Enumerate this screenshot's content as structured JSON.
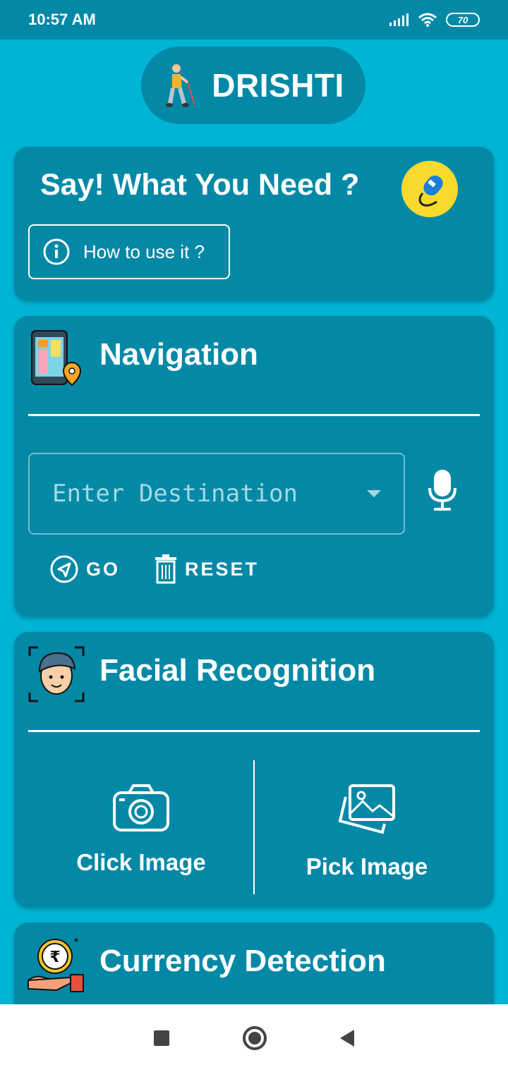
{
  "status_bar": {
    "time": "10:57 AM",
    "battery": "70",
    "icons": [
      "signal-icon",
      "wifi-icon",
      "battery-icon"
    ]
  },
  "app": {
    "title": "DRISHTI",
    "logo_icon": "blind-person-with-cane-icon"
  },
  "voice_card": {
    "title": "Say! What You Need ?",
    "mic_icon": "microphone-icon",
    "help_button": "How to use it ?"
  },
  "navigation": {
    "title": "Navigation",
    "icon": "map-phone-icon",
    "destination_placeholder": "Enter Destination",
    "go_label": "GO",
    "reset_label": "RESET"
  },
  "facial_recognition": {
    "title": "Facial Recognition",
    "icon": "face-scan-icon",
    "click_image_label": "Click Image",
    "pick_image_label": "Pick Image"
  },
  "currency_detection": {
    "title": "Currency Detection",
    "icon": "rupee-coin-hand-icon"
  },
  "colors": {
    "background": "#00b4d4",
    "card": "#0389a6",
    "accent_yellow": "#f7da2b",
    "text": "#ffffff"
  },
  "system_nav": {
    "buttons": [
      "recents-button",
      "home-button",
      "back-button"
    ]
  }
}
